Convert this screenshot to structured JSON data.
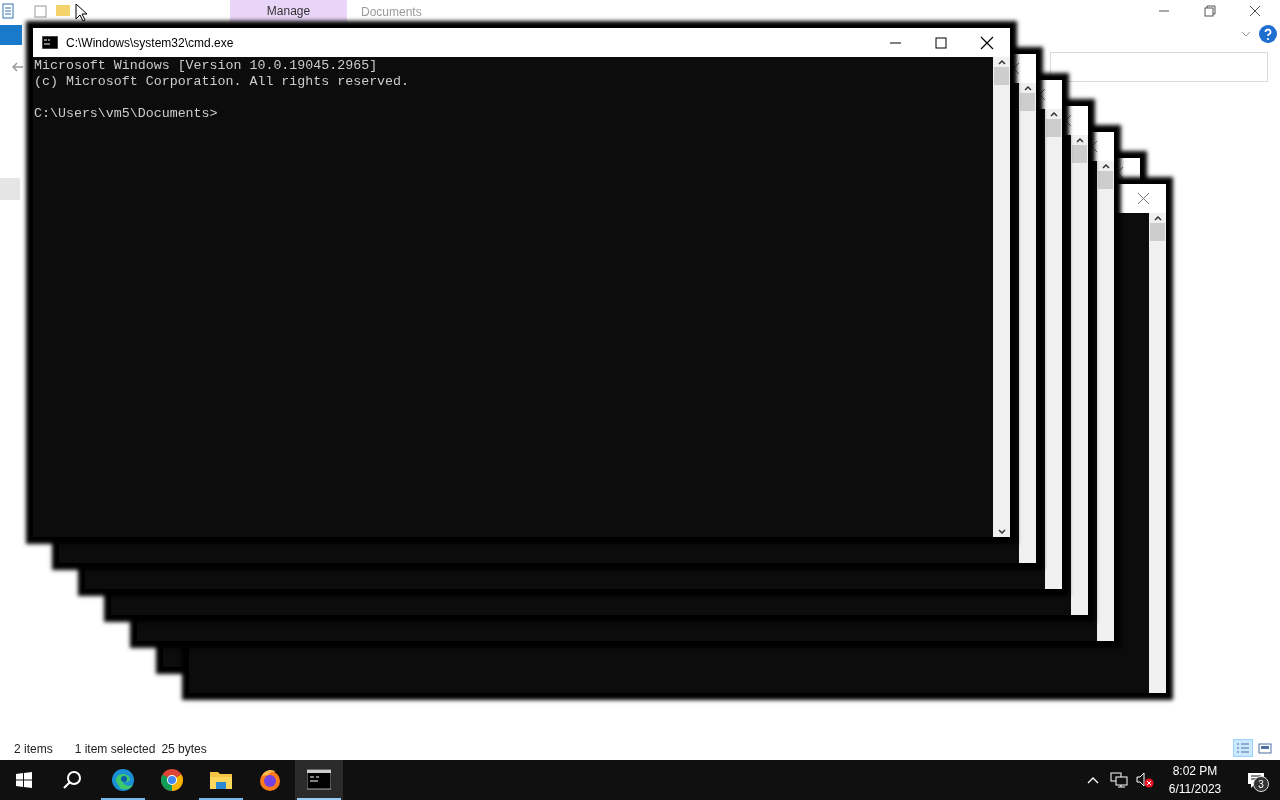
{
  "explorer": {
    "contextual_tab": "Manage",
    "title": "Documents",
    "status_bar": {
      "item_count": "2 items",
      "selection": "1 item selected",
      "size": "25 bytes"
    },
    "view_buttons": [
      {
        "kind": "details",
        "selected": true
      },
      {
        "kind": "large-icons",
        "selected": false
      }
    ]
  },
  "cmd_window": {
    "title": "C:\\Windows\\system32\\cmd.exe",
    "output": [
      "Microsoft Windows [Version 10.0.19045.2965]",
      "(c) Microsoft Corporation. All rights reserved."
    ],
    "prompt": "C:\\Users\\vm5\\Documents>"
  },
  "taskbar": {
    "apps": [
      {
        "kind": "edge",
        "running": true,
        "selected": false
      },
      {
        "kind": "chrome",
        "running": false,
        "selected": false
      },
      {
        "kind": "file-explorer",
        "running": true,
        "selected": false
      },
      {
        "kind": "firefox",
        "running": false,
        "selected": false
      },
      {
        "kind": "terminal",
        "running": true,
        "selected": true
      }
    ],
    "tray": {
      "volume_muted": true,
      "time": "8:02 PM",
      "date": "6/11/2023",
      "notifications": "3"
    }
  }
}
